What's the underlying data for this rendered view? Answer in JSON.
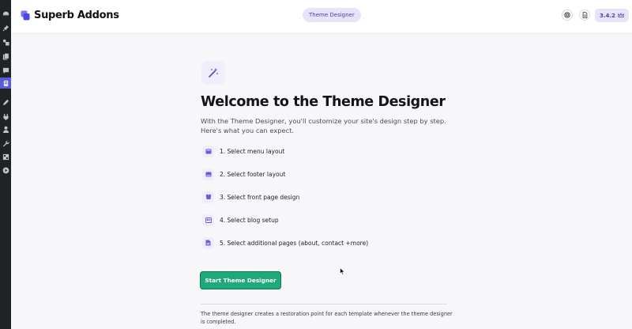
{
  "header": {
    "brand_name": "Superb Addons",
    "center_pill": "Theme Designer",
    "version": "3.4.2"
  },
  "main": {
    "title": "Welcome to the Theme Designer",
    "subtitle": "With the Theme Designer, you'll customize your site's design step by step. Here's what you can expect.",
    "steps": [
      {
        "label": "1. Select menu layout",
        "icon": "menu-layout-icon"
      },
      {
        "label": "2. Select footer layout",
        "icon": "footer-layout-icon"
      },
      {
        "label": "3. Select front page design",
        "icon": "front-page-icon"
      },
      {
        "label": "4. Select blog setup",
        "icon": "blog-icon"
      },
      {
        "label": "5. Select additional pages (about, contact +more)",
        "icon": "pages-icon"
      }
    ],
    "start_button": "Start Theme Designer",
    "footnote": "The theme designer creates a restoration point for each template whenever the theme designer is completed."
  },
  "colors": {
    "accent": "#5b5bd6",
    "start_button": "#1fa97a",
    "pill_bg": "#e6e4f6",
    "sidebar_bg": "#1d2327"
  }
}
